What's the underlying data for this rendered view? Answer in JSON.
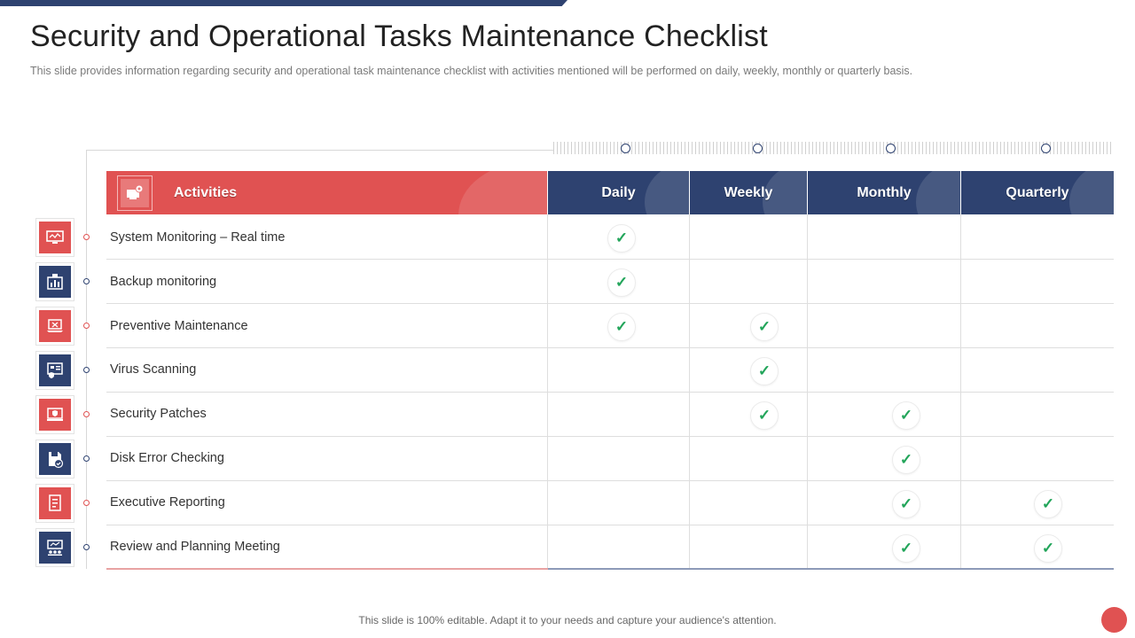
{
  "header": {
    "title": "Security and Operational Tasks Maintenance Checklist",
    "subtitle": "This slide provides information regarding security and operational task maintenance checklist with activities mentioned will be performed on daily, weekly, monthly or quarterly basis."
  },
  "table": {
    "headers": {
      "activities": "Activities",
      "daily": "Daily",
      "weekly": "Weekly",
      "monthly": "Monthly",
      "quarterly": "Quarterly"
    },
    "check_symbol": "✓",
    "rows": [
      {
        "activity": "System Monitoring – Real time",
        "icon": "monitor-icon",
        "daily": true,
        "weekly": false,
        "monthly": false,
        "quarterly": false
      },
      {
        "activity": "Backup monitoring",
        "icon": "building-chart-icon",
        "daily": true,
        "weekly": false,
        "monthly": false,
        "quarterly": false
      },
      {
        "activity": "Preventive Maintenance",
        "icon": "laptop-tools-icon",
        "daily": true,
        "weekly": true,
        "monthly": false,
        "quarterly": false
      },
      {
        "activity": "Virus Scanning",
        "icon": "dashboard-shield-icon",
        "daily": false,
        "weekly": true,
        "monthly": false,
        "quarterly": false
      },
      {
        "activity": "Security Patches",
        "icon": "laptop-shield-icon",
        "daily": false,
        "weekly": true,
        "monthly": true,
        "quarterly": false
      },
      {
        "activity": "Disk Error Checking",
        "icon": "floppy-check-icon",
        "daily": false,
        "weekly": false,
        "monthly": true,
        "quarterly": false
      },
      {
        "activity": "Executive Reporting",
        "icon": "report-document-icon",
        "daily": false,
        "weekly": false,
        "monthly": true,
        "quarterly": true
      },
      {
        "activity": "Review and Planning Meeting",
        "icon": "meeting-board-icon",
        "daily": false,
        "weekly": false,
        "monthly": true,
        "quarterly": true
      }
    ]
  },
  "footer": {
    "note": "This slide is 100% editable. Adapt it to your needs and capture your audience's attention."
  },
  "colors": {
    "accent_red": "#e05252",
    "accent_blue": "#2e4270",
    "check_green": "#22a55a"
  }
}
